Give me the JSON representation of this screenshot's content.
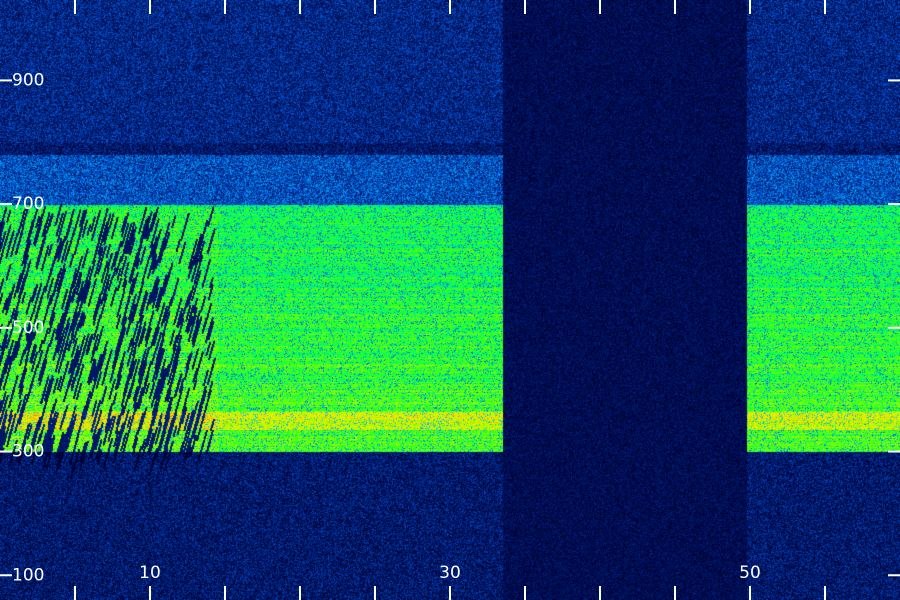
{
  "chart_data": {
    "type": "heatmap",
    "title": "",
    "xlabel": "",
    "ylabel": "",
    "x_ticks": [
      {
        "value": 10,
        "label": "10"
      },
      {
        "value": 30,
        "label": "30"
      },
      {
        "value": 50,
        "label": "50"
      }
    ],
    "x_minor_ticks": [
      5,
      15,
      20,
      25,
      35,
      40,
      45,
      55
    ],
    "y_ticks": [
      {
        "value": 100,
        "label": "100"
      },
      {
        "value": 300,
        "label": "300"
      },
      {
        "value": 500,
        "label": "500"
      },
      {
        "value": 700,
        "label": "700"
      },
      {
        "value": 900,
        "label": "900"
      }
    ],
    "xlim": [
      0,
      60
    ],
    "ylim": [
      60,
      1030
    ],
    "colormap": [
      "#000033",
      "#001a6e",
      "#0050d0",
      "#00b4ff",
      "#00e6b4",
      "#00ff50",
      "#5aff00",
      "#c8ff00",
      "#ffdc00",
      "#ff6400"
    ],
    "regions": [
      {
        "name": "gated-block",
        "x": [
          0,
          14.5
        ],
        "y": [
          300,
          700
        ],
        "intensity": 0.64,
        "texture": "dark-streaks"
      },
      {
        "name": "main-band",
        "x": [
          14.5,
          33.5
        ],
        "y": [
          300,
          700
        ],
        "intensity": 0.6,
        "texture": "smooth"
      },
      {
        "name": "gap",
        "x": [
          33.5,
          49.8
        ],
        "y": [
          60,
          1030
        ],
        "intensity": 0.06,
        "texture": "noise"
      },
      {
        "name": "right-band",
        "x": [
          49.8,
          60
        ],
        "y": [
          300,
          700
        ],
        "intensity": 0.6,
        "texture": "smooth"
      }
    ],
    "hot_band": {
      "y": [
        335,
        365
      ],
      "boost": 0.18
    },
    "diffuse_band": {
      "y": [
        700,
        780
      ],
      "intensity": 0.22
    }
  }
}
